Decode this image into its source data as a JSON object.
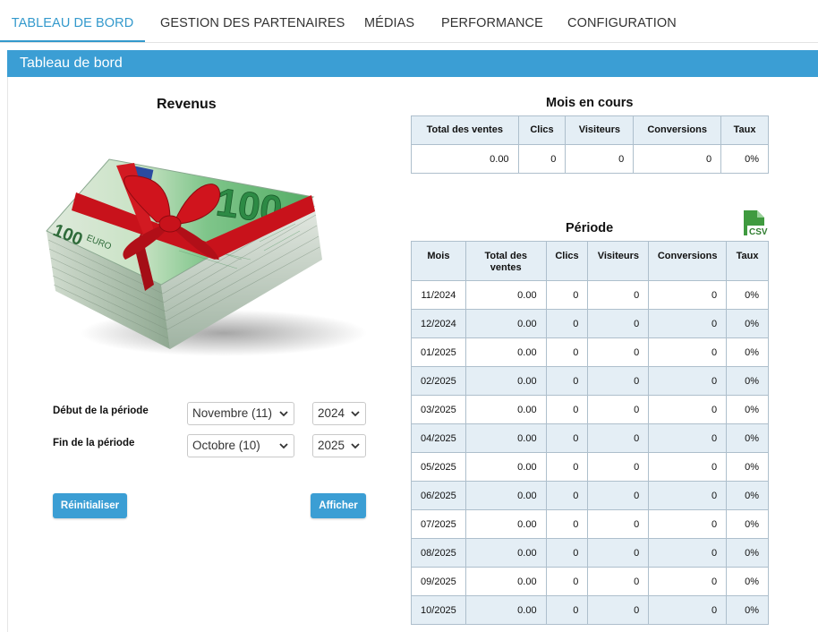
{
  "nav": {
    "tabs": [
      {
        "label": "TABLEAU DE BORD",
        "active": true
      },
      {
        "label": "GESTION DES PARTENAIRES"
      },
      {
        "label": "MÉDIAS"
      },
      {
        "label": "PERFORMANCE"
      },
      {
        "label": "CONFIGURATION"
      }
    ]
  },
  "panel": {
    "title": "Tableau de bord"
  },
  "revenus": {
    "title": "Revenus",
    "image_icon": "euro-banknotes-gift-image"
  },
  "form": {
    "start_label": "Début de la période",
    "end_label": "Fin de la période",
    "start_month": "Novembre (11)",
    "start_year": "2024",
    "end_month": "Octobre (10)",
    "end_year": "2025",
    "reset_label": "Réinitialiser",
    "show_label": "Afficher"
  },
  "current_month": {
    "title": "Mois en cours",
    "headers": [
      "Total des ventes",
      "Clics",
      "Visiteurs",
      "Conversions",
      "Taux"
    ],
    "row": [
      "0.00",
      "0",
      "0",
      "0",
      "0%"
    ]
  },
  "period": {
    "title": "Période",
    "csv_label": "CSV",
    "headers": [
      "Mois",
      "Total des ventes",
      "Clics",
      "Visiteurs",
      "Conversions",
      "Taux"
    ],
    "rows": [
      [
        "11/2024",
        "0.00",
        "0",
        "0",
        "0",
        "0%"
      ],
      [
        "12/2024",
        "0.00",
        "0",
        "0",
        "0",
        "0%"
      ],
      [
        "01/2025",
        "0.00",
        "0",
        "0",
        "0",
        "0%"
      ],
      [
        "02/2025",
        "0.00",
        "0",
        "0",
        "0",
        "0%"
      ],
      [
        "03/2025",
        "0.00",
        "0",
        "0",
        "0",
        "0%"
      ],
      [
        "04/2025",
        "0.00",
        "0",
        "0",
        "0",
        "0%"
      ],
      [
        "05/2025",
        "0.00",
        "0",
        "0",
        "0",
        "0%"
      ],
      [
        "06/2025",
        "0.00",
        "0",
        "0",
        "0",
        "0%"
      ],
      [
        "07/2025",
        "0.00",
        "0",
        "0",
        "0",
        "0%"
      ],
      [
        "08/2025",
        "0.00",
        "0",
        "0",
        "0",
        "0%"
      ],
      [
        "09/2025",
        "0.00",
        "0",
        "0",
        "0",
        "0%"
      ],
      [
        "10/2025",
        "0.00",
        "0",
        "0",
        "0",
        "0%"
      ]
    ]
  },
  "colors": {
    "accent": "#3b9ed4",
    "header_bg": "#e4eef5",
    "border": "#aebfcc",
    "banknote_green": "#7fc58a",
    "ribbon_red": "#c8121b"
  }
}
